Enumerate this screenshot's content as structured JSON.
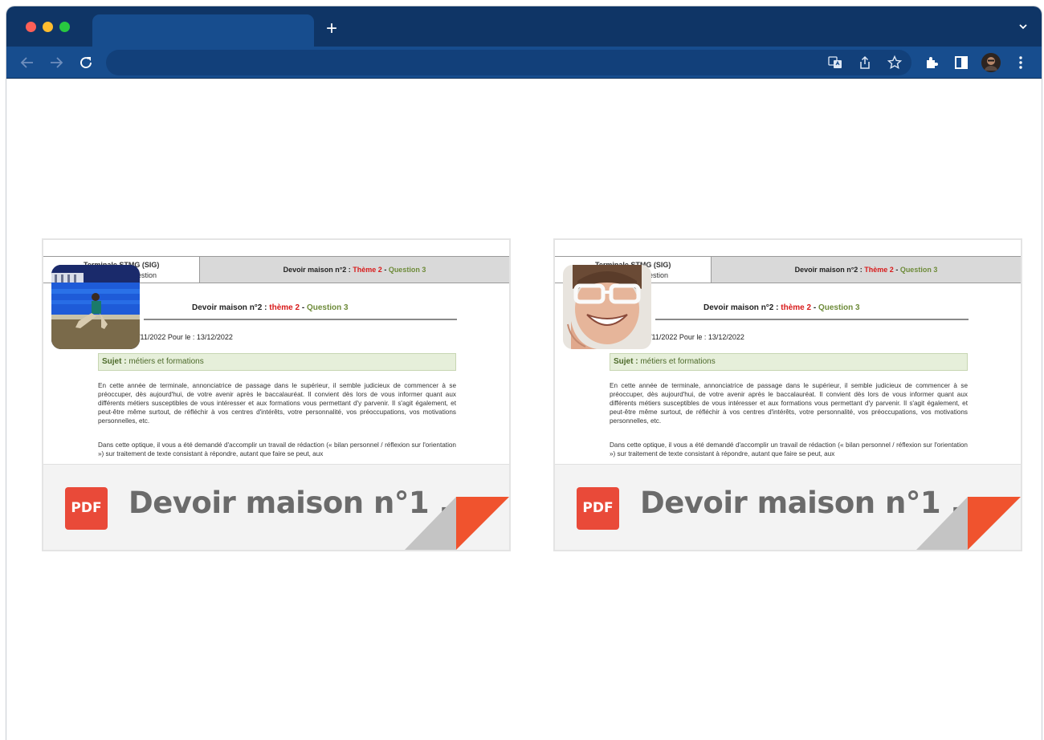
{
  "browser": {
    "tab_title": "",
    "new_tab_label": "+",
    "address": ""
  },
  "colors": {
    "tabbar": "#0f3566",
    "toolbar": "#174d8e",
    "pdf_red": "#e94a39",
    "fold_orange": "#f0532e"
  },
  "cards": [
    {
      "doc_header_left_1": "Terminale STMG (SIG)",
      "doc_header_left_2": "n de Gestion",
      "doc_header_right_prefix": "Devoir maison n°2 : ",
      "doc_header_right_theme": "Thème 2",
      "doc_header_right_sep": " - ",
      "doc_header_right_question": "Question 3",
      "doc_title_prefix": "Devoir maison n°2 : ",
      "doc_title_theme": "thème 2",
      "doc_title_sep": " - ",
      "doc_title_question": "Question 3",
      "doc_date": "/11/2022 Pour le : 13/12/2022",
      "subject_label": "Sujet : ",
      "subject_text": "métiers et formations",
      "para1": "En cette année de terminale, annonciatrice de passage dans le supérieur, il semble judicieux de commencer à se préoccuper, dès aujourd'hui, de votre avenir après le baccalauréat. Il convient dès lors de vous informer quant aux différents métiers susceptibles de vous intéresser et aux formations vous permettant d'y parvenir. Il s'agit également, et peut-être même surtout, de réfléchir à vos centres d'intérêts, votre personnalité, vos préoccupations, vos motivations personnelles, etc.",
      "para2": "Dans cette optique, il vous a été demandé d'accomplir un travail de rédaction (« bilan personnel / réflexion sur l'orientation ») sur traitement de texte consistant à répondre, autant que faire se peut, aux",
      "pdf_badge": "PDF",
      "file_title": "Devoir maison n°1 ..."
    },
    {
      "doc_header_left_1": "Terminale STMG (SIG)",
      "doc_header_left_2": "n de Gestion",
      "doc_header_right_prefix": "Devoir maison n°2 : ",
      "doc_header_right_theme": "Thème 2",
      "doc_header_right_sep": " - ",
      "doc_header_right_question": "Question 3",
      "doc_title_prefix": "Devoir maison n°2 : ",
      "doc_title_theme": "thème 2",
      "doc_title_sep": " - ",
      "doc_title_question": "Question 3",
      "doc_date": "/11/2022 Pour le : 13/12/2022",
      "subject_label": "Sujet : ",
      "subject_text": "métiers et formations",
      "para1": "En cette année de terminale, annonciatrice de passage dans le supérieur, il semble judicieux de commencer à se préoccuper, dès aujourd'hui, de votre avenir après le baccalauréat. Il convient dès lors de vous informer quant aux différents métiers susceptibles de vous intéresser et aux formations vous permettant d'y parvenir. Il s'agit également, et peut-être même surtout, de réfléchir à vos centres d'intérêts, votre personnalité, vos préoccupations, vos motivations personnelles, etc.",
      "para2": "Dans cette optique, il vous a été demandé d'accomplir un travail de rédaction (« bilan personnel / réflexion sur l'orientation ») sur traitement de texte consistant à répondre, autant que faire se peut, aux",
      "pdf_badge": "PDF",
      "file_title": "Devoir maison n°1 ..."
    }
  ]
}
